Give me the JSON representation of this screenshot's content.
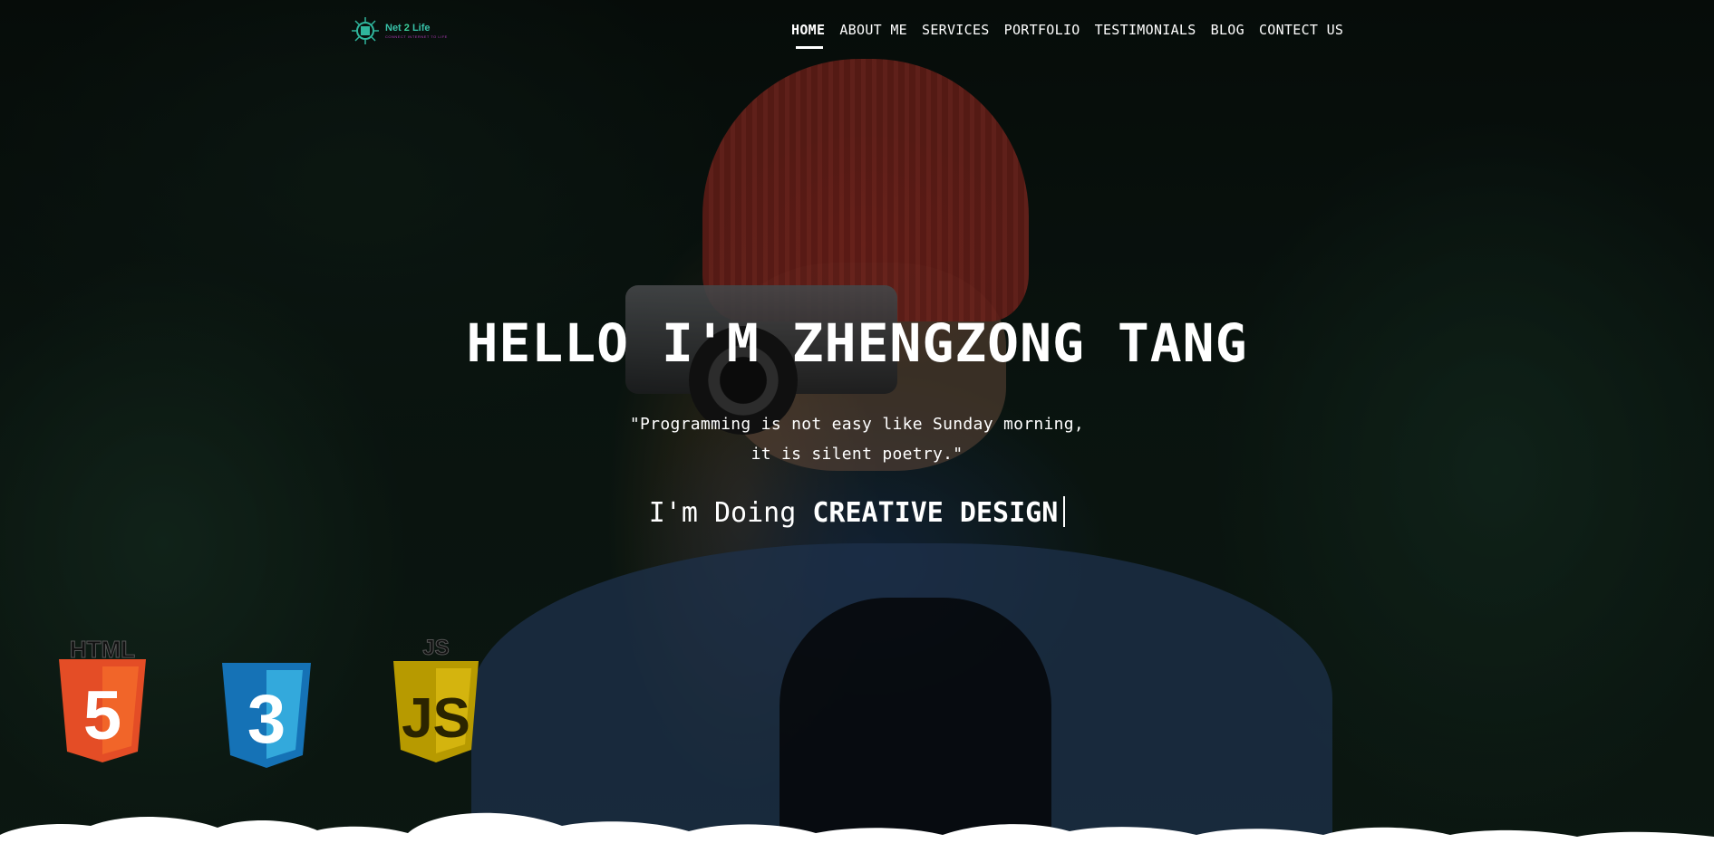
{
  "header": {
    "logo": {
      "name_part1": "Net ",
      "name_part2": "2",
      "name_part3": " Life",
      "tagline": "CONNECT INTERNET TO LIFE"
    },
    "nav": [
      {
        "label": "HOME",
        "active": true
      },
      {
        "label": "ABOUT ME"
      },
      {
        "label": "SERVICES"
      },
      {
        "label": "PORTFOLIO"
      },
      {
        "label": "TESTIMONIALS"
      },
      {
        "label": "BLOG"
      },
      {
        "label": "CONTECT US"
      }
    ]
  },
  "hero": {
    "title": "HELLO I'M ZHENGZONG TANG",
    "quote_line1": "\"Programming is not easy like Sunday morning,",
    "quote_line2": "it is silent poetry.\"",
    "doing_prefix": "I'm Doing",
    "doing_typed": "CREATIVE DESIGN"
  },
  "badges": [
    {
      "name": "html5-icon",
      "label": "HTML",
      "glyph": "5",
      "colors": {
        "outer": "#e44d26",
        "inner": "#f16529"
      }
    },
    {
      "name": "css3-icon",
      "label": "",
      "glyph": "3",
      "colors": {
        "outer": "#1572b6",
        "inner": "#33a9dc"
      }
    },
    {
      "name": "javascript-icon",
      "label": "JS",
      "glyph": "JS",
      "colors": {
        "outer": "#b79a00",
        "inner": "#d4b40e"
      }
    }
  ]
}
